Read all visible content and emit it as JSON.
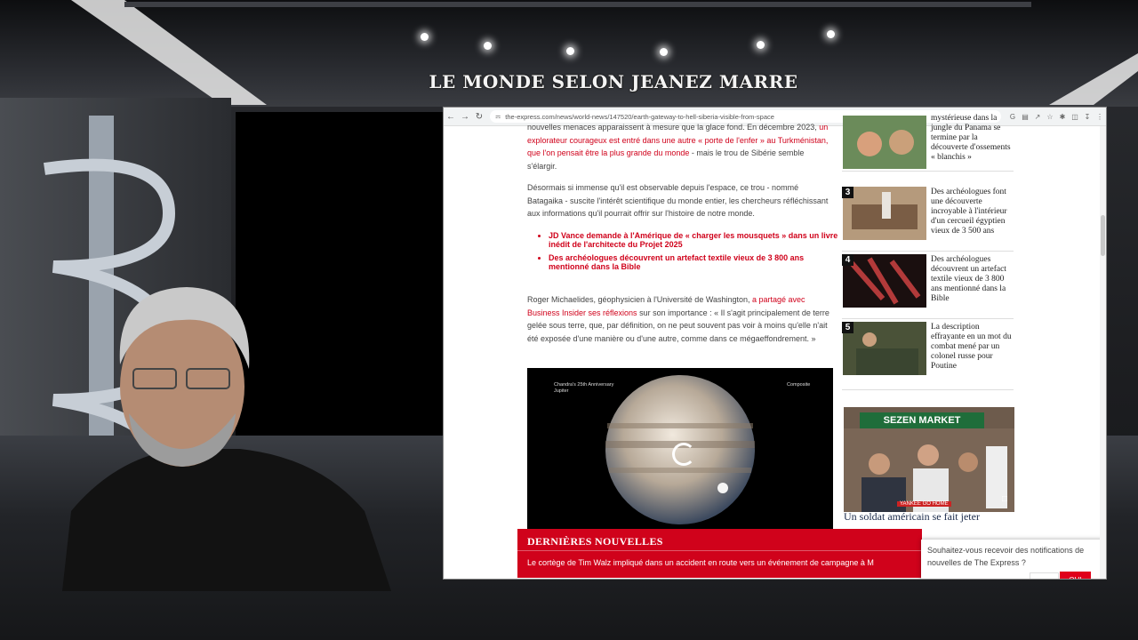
{
  "banner": {
    "title": "LE MONDE SELON JEANEZ MARRE"
  },
  "browser": {
    "url": "the-express.com/news/world-news/147520/earth-gateway-to-hell-siberia-visible-from-space",
    "icons": [
      "back-icon",
      "forward-icon",
      "reload-icon",
      "lock-icon",
      "google-icon",
      "translate-icon",
      "share-icon",
      "star-icon",
      "extensions-icon",
      "sidebar-icon",
      "download-icon",
      "menu-icon"
    ]
  },
  "article": {
    "p1_pre": "nouvelles menaces apparaissent à mesure que la glace fond. En décembre 2023, ",
    "p1_link": "un explorateur courageux est entré dans une autre « porte de l'enfer » au Turkménistan, que l'on pensait être la plus grande du monde",
    "p1_post": " - mais le trou de Sibérie semble s'élargir.",
    "p2": "Désormais si immense qu'il est observable depuis l'espace, ce trou - nommé Batagaika - suscite l'intérêt scientifique du monde entier, les chercheurs réfléchissant aux informations qu'il pourrait offrir sur l'histoire de notre monde.",
    "related": [
      "JD Vance demande à l'Amérique de « charger les mousquets » dans un livre inédit de l'architecte du Projet 2025",
      "Des archéologues découvrent un artefact textile vieux de 3 800 ans mentionné dans la Bible"
    ],
    "p3_pre": "Roger Michaelides, géophysicien à l'Université de Washington, ",
    "p3_link": "a partagé avec Business Insider ses réflexions",
    "p3_post": " sur son importance : « Il s'agit principalement de terre gelée sous terre, que, par définition, on ne peut souvent pas voir à moins qu'elle n'ait été exposée d'une manière ou d'une autre, comme dans ce mégaeffondrement. »",
    "figure": {
      "caption_left": "Chandra's 25th Anniversary\nJupiter",
      "caption_right": "Composite"
    }
  },
  "sidebar": {
    "ranked": [
      {
        "num": "",
        "text": "mystérieuse dans la jungle du Panama se termine par la découverte d'ossements « blanchis »"
      },
      {
        "num": "3",
        "text": "Des archéologues font une découverte incroyable à l'intérieur d'un cercueil égyptien vieux de 3 500 ans"
      },
      {
        "num": "4",
        "text": "Des archéologues découvrent un artefact textile vieux de 3 800 ans mentionné dans la Bible"
      },
      {
        "num": "5",
        "text": "La description effrayante en un mot du combat mené par un colonel russe pour Poutine"
      }
    ],
    "story_sign": "SEZEN MARKET",
    "story_banner": "YANKEE GO HOME",
    "story_title": "Un soldat américain se fait jeter"
  },
  "breaking": {
    "title": "DERNIÈRES NOUVELLES",
    "text": "Le cortège de Tim Walz impliqué dans un accident en route vers un événement de campagne à M"
  },
  "notification": {
    "text": "Souhaitez-vous recevoir des notifications de nouvelles de The Express ?",
    "no": "NON",
    "yes": "OUI"
  }
}
